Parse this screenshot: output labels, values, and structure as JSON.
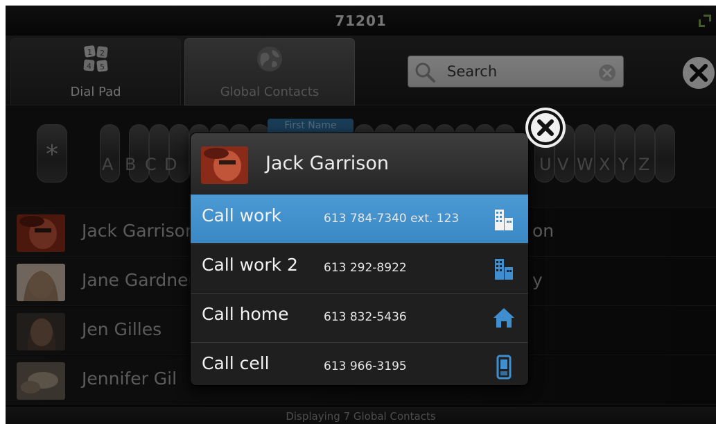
{
  "titlebar": {
    "title": "71201"
  },
  "tabs": {
    "dialpad": {
      "label": "Dial Pad"
    },
    "global": {
      "label": "Global Contacts"
    }
  },
  "search": {
    "placeholder": "Search"
  },
  "alpha": {
    "star": "*",
    "sort_badge": "First Name",
    "letters_left": [
      "A",
      "B",
      "C",
      "D"
    ],
    "letters_right": [
      "U",
      "V",
      "W",
      "X",
      "Y",
      "Z"
    ]
  },
  "contacts": [
    {
      "name": "Jack Garrison",
      "right": "on"
    },
    {
      "name": "Jane Gardner",
      "right": "y"
    },
    {
      "name": "Jen Gilles",
      "right": ""
    },
    {
      "name": "Jennifer Gil",
      "right": ""
    }
  ],
  "status": {
    "text": "Displaying 7 Global Contacts"
  },
  "popup": {
    "name": "Jack Garrison",
    "options": [
      {
        "label": "Call work",
        "number": "613 784-7340 ext. 123",
        "icon": "building-icon",
        "selected": true
      },
      {
        "label": "Call work 2",
        "number": "613 292-8922",
        "icon": "building-icon",
        "selected": false
      },
      {
        "label": "Call home",
        "number": "613 832-5436",
        "icon": "home-icon",
        "selected": false
      },
      {
        "label": "Call cell",
        "number": "613 966-3195",
        "icon": "mobile-phone-icon",
        "selected": false
      }
    ]
  },
  "colors": {
    "accent": "#4195d0",
    "icon_blue": "#3f8fd0",
    "background": "#0e0e0e"
  }
}
